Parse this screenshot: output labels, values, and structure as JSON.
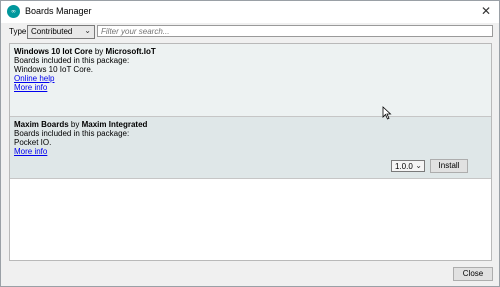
{
  "window": {
    "title": "Boards Manager",
    "app_icon_text": "∞"
  },
  "filter": {
    "type_label": "Type",
    "type_value": "Contributed",
    "search_placeholder": "Filter your search..."
  },
  "packages": [
    {
      "name": "Windows 10 Iot Core",
      "by": "by",
      "author": "Microsoft.IoT",
      "boards_label": "Boards included in this package:",
      "boards": "Windows 10 IoT Core.",
      "online_help": "Online help",
      "more_info": "More info"
    },
    {
      "name": "Maxim Boards",
      "by": "by",
      "author": "Maxim Integrated",
      "boards_label": "Boards included in this package:",
      "boards": "Pocket IO.",
      "more_info": "More info",
      "version": "1.0.0",
      "install_label": "Install"
    }
  ],
  "footer": {
    "close_label": "Close"
  },
  "icons": {
    "close": "close-icon",
    "chevron": "chevron-down-icon",
    "cursor": "mouse-cursor-icon"
  }
}
